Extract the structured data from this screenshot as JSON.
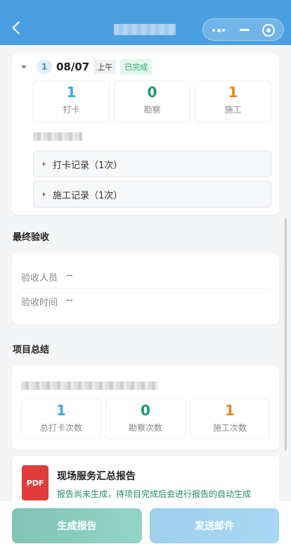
{
  "header": {
    "back_icon": "chevron-left-icon",
    "menu_icon": "more-dots-icon",
    "minimize_icon": "minimize-icon",
    "close_icon": "target-close-icon"
  },
  "day": {
    "number": "1",
    "date": "08/07",
    "period": "上午",
    "status": "已完成",
    "stats": [
      {
        "value": "1",
        "label": "打卡"
      },
      {
        "value": "0",
        "label": "勘察"
      },
      {
        "value": "1",
        "label": "施工"
      }
    ],
    "records": [
      {
        "label": "打卡记录（1次）"
      },
      {
        "label": "施工记录（1次）"
      }
    ]
  },
  "final_acceptance": {
    "title": "最终验收",
    "inspector_label": "验收人员",
    "inspector_value": "--",
    "time_label": "验收时间",
    "time_value": "--"
  },
  "summary": {
    "title": "项目总结",
    "stats": [
      {
        "value": "1",
        "label": "总打卡次数"
      },
      {
        "value": "0",
        "label": "勘察次数"
      },
      {
        "value": "1",
        "label": "施工次数"
      }
    ]
  },
  "report": {
    "icon_text": "PDF",
    "title": "现场服务汇总报告",
    "desc": "报告尚未生成，待项目完成后会进行报告的自动生成"
  },
  "actions": {
    "generate": "生成报告",
    "send": "发送邮件"
  },
  "colors": {
    "header": "#4a9fe0",
    "blue_stat": "#39a8e6",
    "green_stat": "#1a9b6f",
    "orange_stat": "#e8881a"
  }
}
